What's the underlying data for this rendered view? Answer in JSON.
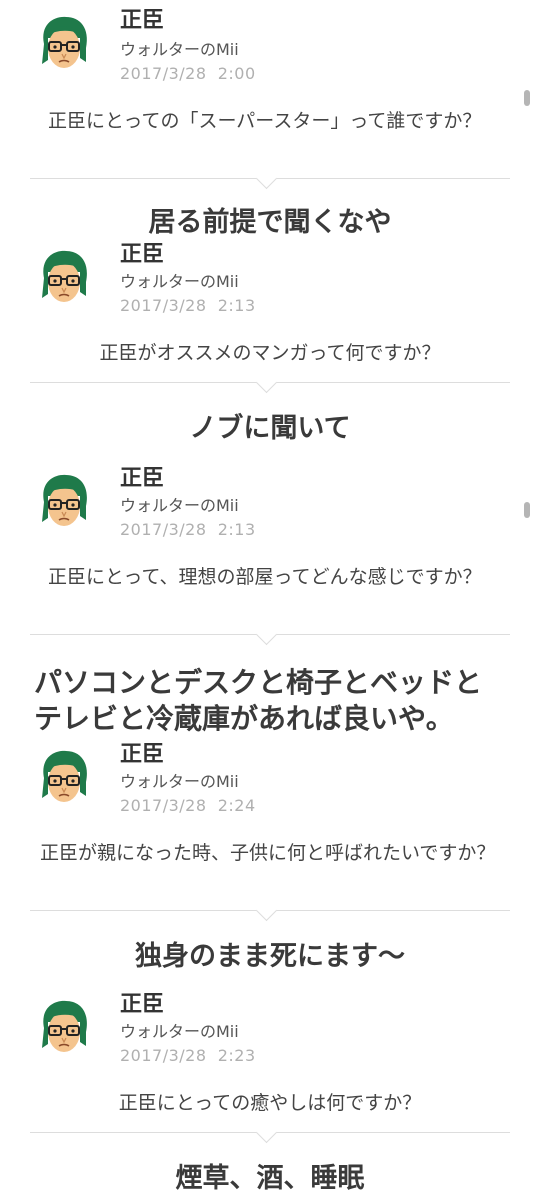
{
  "posts": [
    {
      "author": "正臣",
      "mii_label": "ウォルターのMii",
      "timestamp": "2017/3/28  2:00",
      "question": "正臣にとっての「スーパースター」って誰ですか？",
      "answer": "居る前提で聞くなや"
    },
    {
      "author": "正臣",
      "mii_label": "ウォルターのMii",
      "timestamp": "2017/3/28  2:13",
      "question": "正臣がオススメのマンガって何ですか？",
      "answer": "ノブに聞いて"
    },
    {
      "author": "正臣",
      "mii_label": "ウォルターのMii",
      "timestamp": "2017/3/28  2:13",
      "question": "正臣にとって、理想の部屋ってどんな感じですか？",
      "answer_lines": [
        "パソコンとデスクと椅子とベッドと",
        "テレビと冷蔵庫があれば良いや。"
      ]
    },
    {
      "author": "正臣",
      "mii_label": "ウォルターのMii",
      "timestamp": "2017/3/28  2:24",
      "question": "正臣が親になった時、子供に何と呼ばれたいですか？",
      "answer": "独身のまま死にます～"
    },
    {
      "author": "正臣",
      "mii_label": "ウォルターのMii",
      "timestamp": "2017/3/28  2:23",
      "question": "正臣にとっての癒やしは何ですか？",
      "answer": "煙草、酒、睡眠"
    }
  ],
  "colors": {
    "hair": "#1f7a4a",
    "skin": "#f4c48e",
    "divider": "#dddddd",
    "timestamp": "#b0b0b0"
  }
}
